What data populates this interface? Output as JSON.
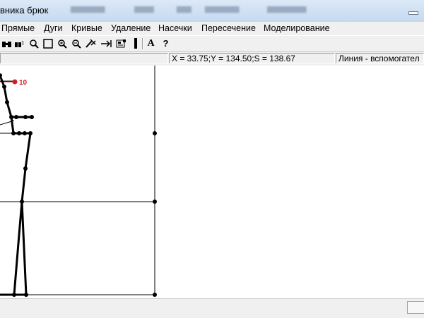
{
  "window": {
    "title": "вника брюк"
  },
  "menu": {
    "items": [
      "Прямые",
      "Дуги",
      "Кривые",
      "Удаление",
      "Насечки",
      "Пересечение",
      "Моделирование"
    ]
  },
  "status": {
    "coords": "X = 33.75;Y = 134.50;S = 138.67",
    "mode": "Линия - вспомогател"
  },
  "canvas": {
    "point_label": "10",
    "colors": {
      "pattern": "#000000",
      "highlight": "#cc2222",
      "grid": "#000000"
    }
  },
  "toolbar": {
    "icons": [
      "binoculars-icon",
      "binoculars-number-icon",
      "magnifier-icon",
      "rectangle-select-icon",
      "zoom-in-icon",
      "zoom-out-icon",
      "pointer-cross-icon",
      "arrow-to-line-icon",
      "measure-icon",
      "line-thickness-icon",
      "text-icon",
      "help-icon"
    ],
    "text_a": "A",
    "text_help": "?"
  }
}
